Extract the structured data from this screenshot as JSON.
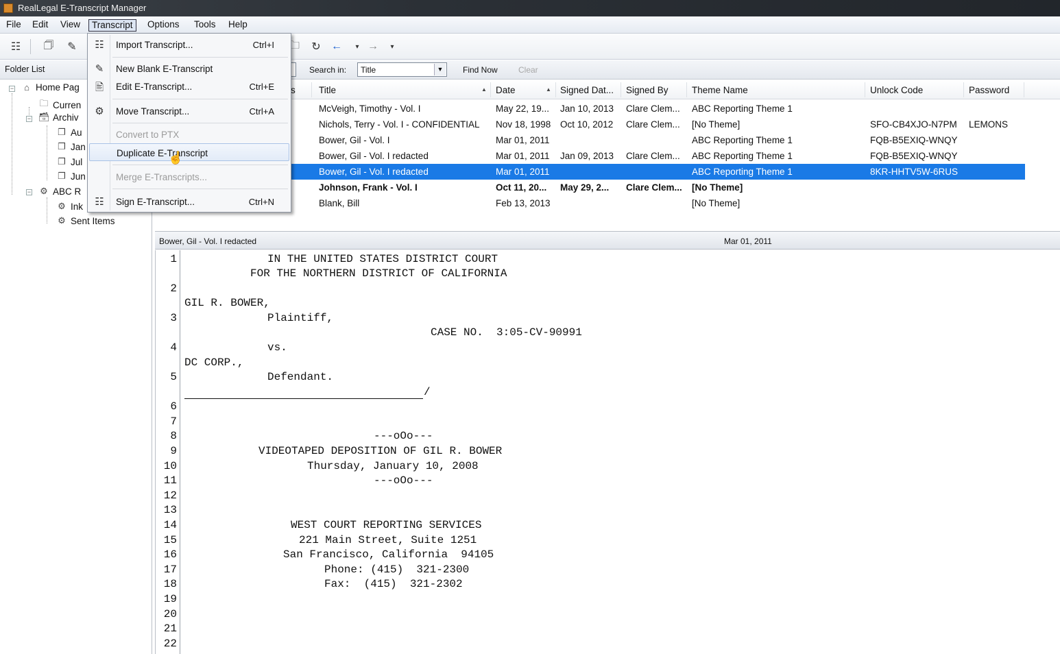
{
  "window": {
    "title": "RealLegal E-Transcript Manager"
  },
  "menubar": {
    "items": [
      "File",
      "Edit",
      "View",
      "Transcript",
      "Options",
      "Tools",
      "Help"
    ]
  },
  "transcript_menu": {
    "items": [
      {
        "label": "Import Transcript...",
        "shortcut": "Ctrl+I",
        "icon": "import-icon",
        "enabled": true
      },
      {
        "label": "New Blank E-Transcript",
        "shortcut": "",
        "icon": "new-doc-icon",
        "enabled": true
      },
      {
        "label": "Edit E-Transcript...",
        "shortcut": "Ctrl+E",
        "icon": "edit-doc-icon",
        "enabled": true
      },
      {
        "label": "Move Transcript...",
        "shortcut": "Ctrl+A",
        "icon": "move-icon",
        "enabled": true
      },
      {
        "label": "Convert to PTX",
        "shortcut": "",
        "icon": "",
        "enabled": false
      },
      {
        "label": "Duplicate E-Transcript",
        "shortcut": "",
        "icon": "",
        "enabled": true,
        "hover": true
      },
      {
        "label": "Merge E-Transcripts...",
        "shortcut": "",
        "icon": "",
        "enabled": false
      },
      {
        "label": "Sign E-Transcript...",
        "shortcut": "Ctrl+N",
        "icon": "sign-icon",
        "enabled": true
      }
    ]
  },
  "folder_panel": {
    "header": "Folder List",
    "tree": [
      {
        "label": "Home Pag",
        "level": 0,
        "icon": "home-icon"
      },
      {
        "label": "Curren",
        "level": 1,
        "icon": "folder-icon"
      },
      {
        "label": "Archiv",
        "level": 1,
        "icon": "archive-icon"
      },
      {
        "label": "Au",
        "level": 2,
        "icon": "doc-folder-icon"
      },
      {
        "label": "Jan",
        "level": 2,
        "icon": "doc-folder-icon"
      },
      {
        "label": "Jul",
        "level": 2,
        "icon": "doc-folder-icon"
      },
      {
        "label": "Jun",
        "level": 2,
        "icon": "doc-folder-icon"
      },
      {
        "label": "ABC R",
        "level": 1,
        "icon": "network-icon"
      },
      {
        "label": "Ink",
        "level": 2,
        "icon": "inbox-icon"
      },
      {
        "label": "Sent Items",
        "level": 2,
        "icon": "sent-icon"
      }
    ]
  },
  "search": {
    "label": "Search in:",
    "field": "Title",
    "find_now": "Find Now",
    "clear": "Clear"
  },
  "table": {
    "columns": [
      "s",
      "Title",
      "Date",
      "Signed Dat...",
      "Signed By",
      "Theme Name",
      "Unlock Code",
      "Password"
    ],
    "rows": [
      {
        "title": "McVeigh, Timothy - Vol. I",
        "date": "May 22, 19...",
        "signed_date": "Jan 10, 2013",
        "signed_by": "Clare Clem...",
        "theme": "ABC Reporting Theme 1",
        "unlock": "",
        "password": "",
        "selected": false,
        "bold": false
      },
      {
        "title": "Nichols, Terry - Vol. I - CONFIDENTIAL",
        "date": "Nov 18, 1998",
        "signed_date": "Oct 10, 2012",
        "signed_by": "Clare Clem...",
        "theme": "[No Theme]",
        "unlock": "SFO-CB4XJO-N7PM",
        "password": "LEMONS",
        "selected": false,
        "bold": false
      },
      {
        "title": "Bower, Gil - Vol. I",
        "date": "Mar 01, 2011",
        "signed_date": "",
        "signed_by": "",
        "theme": "ABC Reporting Theme 1",
        "unlock": "FQB-B5EXIQ-WNQY",
        "password": "",
        "selected": false,
        "bold": false
      },
      {
        "title": "Bower, Gil - Vol. I redacted",
        "date": "Mar 01, 2011",
        "signed_date": "Jan 09, 2013",
        "signed_by": "Clare Clem...",
        "theme": "ABC Reporting Theme 1",
        "unlock": "FQB-B5EXIQ-WNQY",
        "password": "",
        "selected": false,
        "bold": false
      },
      {
        "title": "Bower, Gil - Vol. I redacted",
        "date": "Mar 01, 2011",
        "signed_date": "",
        "signed_by": "",
        "theme": "ABC Reporting Theme 1",
        "unlock": "8KR-HHTV5W-6RUS",
        "password": "",
        "selected": true,
        "bold": false
      },
      {
        "title": "Johnson, Frank - Vol. I",
        "date": "Oct 11, 20...",
        "signed_date": "May 29, 2...",
        "signed_by": "Clare Clem...",
        "theme": "[No Theme]",
        "unlock": "",
        "password": "",
        "selected": false,
        "bold": true
      },
      {
        "title": "Blank, Bill",
        "date": "Feb 13, 2013",
        "signed_date": "",
        "signed_by": "",
        "theme": "[No Theme]",
        "unlock": "",
        "password": "",
        "selected": false,
        "bold": false
      }
    ]
  },
  "preview": {
    "title": "Bower, Gil - Vol. I redacted",
    "date": "Mar 01, 2011",
    "line_numbers": [
      "1",
      "2",
      "3",
      "4",
      "5",
      "6",
      "7",
      "8",
      "9",
      "10",
      "11",
      "12",
      "13",
      "14",
      "15",
      "16",
      "17",
      "18",
      "19",
      "20",
      "21",
      "22"
    ],
    "text_lines": [
      "IN THE UNITED STATES DISTRICT COURT",
      "FOR THE NORTHERN DISTRICT OF CALIFORNIA",
      "GIL R. BOWER,",
      "Plaintiff,",
      "CASE NO.  3:05-CV-90991",
      "vs.",
      "DC CORP.,",
      "Defendant.",
      "/",
      "---oOo---",
      "VIDEOTAPED DEPOSITION OF GIL R. BOWER",
      "Thursday, January 10, 2008",
      "---oOo---",
      "WEST COURT REPORTING SERVICES",
      "221 Main Street, Suite 1251",
      "San Francisco, California  94105",
      "Phone: (415)  321-2300",
      "Fax:  (415)  321-2302"
    ]
  }
}
